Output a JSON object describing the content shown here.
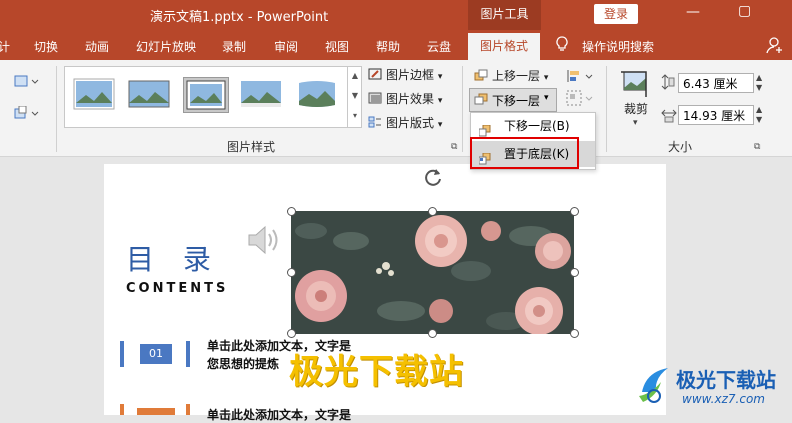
{
  "titlebar": {
    "title": "演示文稿1.pptx  -  PowerPoint",
    "context_tab": "图片工具",
    "login": "登录",
    "min_glyph": "—",
    "max_glyph": "▢"
  },
  "tabs": [
    "计",
    "切换",
    "动画",
    "幻灯片放映",
    "录制",
    "审阅",
    "视图",
    "帮助",
    "云盘",
    "图片格式",
    "操作说明搜索"
  ],
  "ribbon": {
    "picture_border": "图片边框",
    "picture_effects": "图片效果",
    "picture_layout": "图片版式",
    "picture_styles_group": "图片样式",
    "bring_forward": "上移一层",
    "send_backward": "下移一层",
    "crop": "裁剪",
    "height_value": "6.43 厘米",
    "width_value": "14.93 厘米",
    "size_group": "大小"
  },
  "dropdown": {
    "items": [
      {
        "label": "下移一层(B)"
      },
      {
        "label": "置于底层(K)"
      }
    ]
  },
  "slide": {
    "toc_title": "目 录",
    "contents": "CONTENTS",
    "items": [
      {
        "num": "01",
        "line1": "单击此处添加文本，文字是",
        "line2": "您思想的提炼"
      },
      {
        "num": "",
        "line1": "单击此处添加文本，文字是",
        "line2": ""
      }
    ]
  },
  "watermark": {
    "text": "极光下载站",
    "logo_line1": "极光下载站",
    "logo_line2": "www.xz7.com"
  },
  "colors": {
    "titlebar": "#b7472a",
    "accent_blue": "#2e5ca5",
    "item_blue": "#4a78c2",
    "item_orange": "#e07b39",
    "highlight_box": "#e00000"
  }
}
